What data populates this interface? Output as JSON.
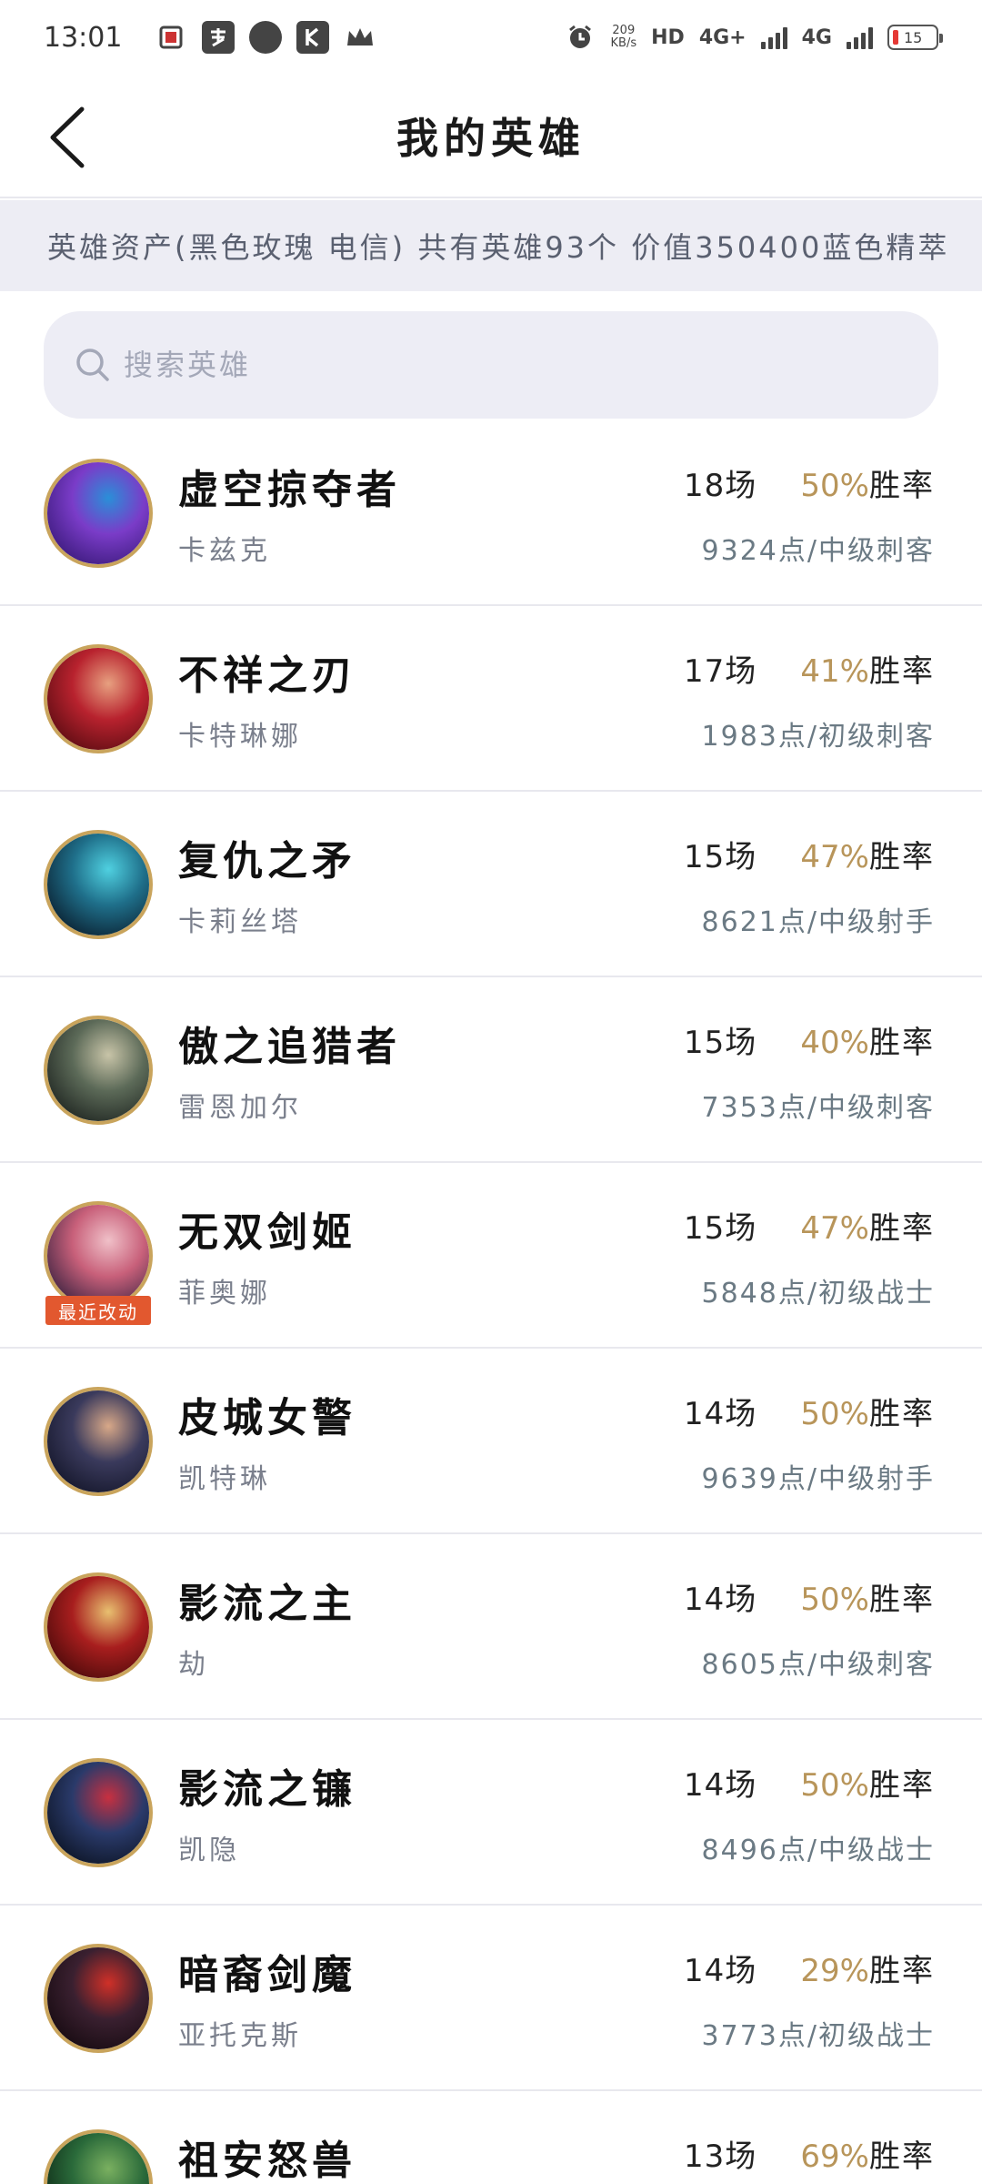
{
  "status_bar": {
    "time": "13:01",
    "net_speed_value": "209",
    "net_speed_unit": "KB/s",
    "hd_label": "HD",
    "sim1_label": "4G+",
    "sim2_label": "4G",
    "battery_level": "15"
  },
  "header": {
    "title": "我的英雄"
  },
  "banner": {
    "text": "英雄资产(黑色玫瑰 电信) 共有英雄93个 价值350400蓝色精萃"
  },
  "search": {
    "placeholder": "搜索英雄"
  },
  "heroes": [
    {
      "title": "虚空掠夺者",
      "name": "卡兹克",
      "games": "18场",
      "winrate": "50%",
      "winrate_label": "胜率",
      "points": "9324点/中级刺客",
      "recent": "",
      "colors": [
        "#3a1a7a",
        "#7a3cc8",
        "#2a8fd8"
      ]
    },
    {
      "title": "不祥之刃",
      "name": "卡特琳娜",
      "games": "17场",
      "winrate": "41%",
      "winrate_label": "胜率",
      "points": "1983点/初级刺客",
      "recent": "",
      "colors": [
        "#5a0c12",
        "#b8222e",
        "#e7a080"
      ]
    },
    {
      "title": "复仇之矛",
      "name": "卡莉丝塔",
      "games": "15场",
      "winrate": "47%",
      "winrate_label": "胜率",
      "points": "8621点/中级射手",
      "recent": "",
      "colors": [
        "#0a1e2e",
        "#1f6f8a",
        "#4fd0e0"
      ]
    },
    {
      "title": "傲之追猎者",
      "name": "雷恩加尔",
      "games": "15场",
      "winrate": "40%",
      "winrate_label": "胜率",
      "points": "7353点/中级刺客",
      "recent": "",
      "colors": [
        "#1e2420",
        "#5c6a58",
        "#c8c4a8"
      ]
    },
    {
      "title": "无双剑姬",
      "name": "菲奥娜",
      "games": "15场",
      "winrate": "47%",
      "winrate_label": "胜率",
      "points": "5848点/初级战士",
      "recent": "最近改动",
      "colors": [
        "#3a2240",
        "#c8607a",
        "#f0c0c8"
      ]
    },
    {
      "title": "皮城女警",
      "name": "凯特琳",
      "games": "14场",
      "winrate": "50%",
      "winrate_label": "胜率",
      "points": "9639点/中级射手",
      "recent": "",
      "colors": [
        "#14162a",
        "#3a3a5c",
        "#d8a888"
      ]
    },
    {
      "title": "影流之主",
      "name": "劫",
      "games": "14场",
      "winrate": "50%",
      "winrate_label": "胜率",
      "points": "8605点/中级刺客",
      "recent": "",
      "colors": [
        "#4a0a0a",
        "#a81e1e",
        "#e8c070"
      ]
    },
    {
      "title": "影流之镰",
      "name": "凯隐",
      "games": "14场",
      "winrate": "50%",
      "winrate_label": "胜率",
      "points": "8496点/中级战士",
      "recent": "",
      "colors": [
        "#0c1424",
        "#2a3a6a",
        "#c83040"
      ]
    },
    {
      "title": "暗裔剑魔",
      "name": "亚托克斯",
      "games": "14场",
      "winrate": "29%",
      "winrate_label": "胜率",
      "points": "3773点/初级战士",
      "recent": "",
      "colors": [
        "#160a10",
        "#3a2030",
        "#d03028"
      ]
    },
    {
      "title": "祖安怒兽",
      "name": "",
      "games": "13场",
      "winrate": "69%",
      "winrate_label": "胜率",
      "points": "",
      "recent": "",
      "colors": [
        "#0c2414",
        "#2a6a3a",
        "#7ab060"
      ]
    }
  ]
}
